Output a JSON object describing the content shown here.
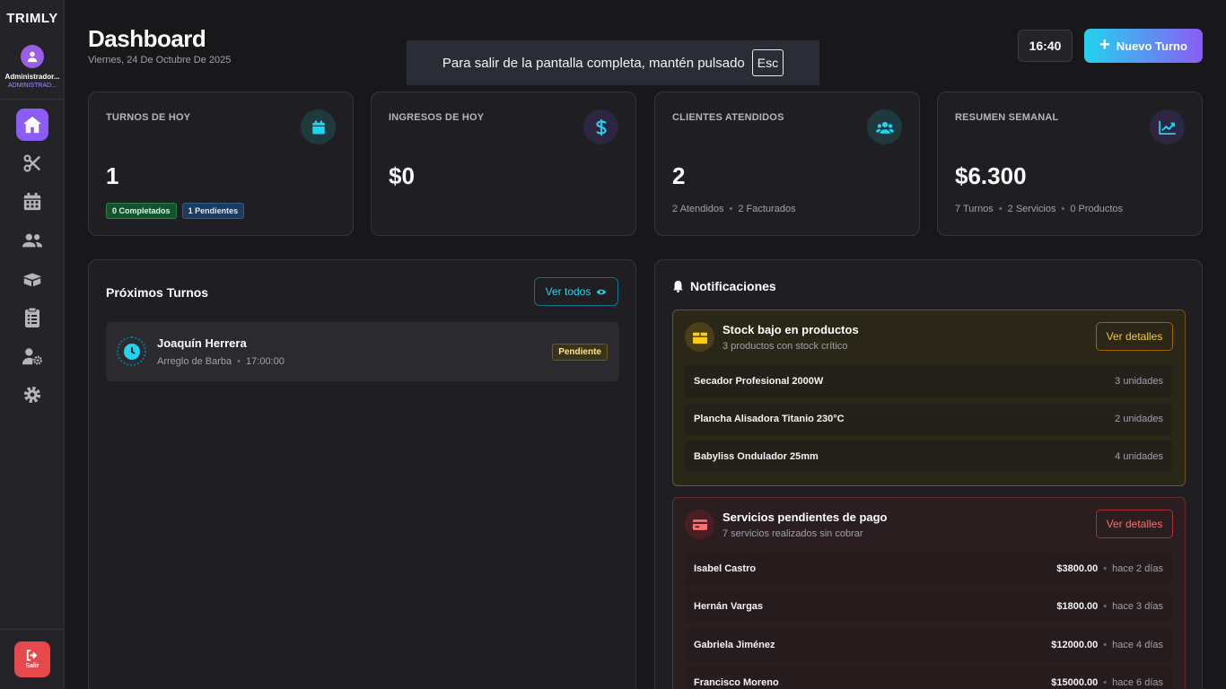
{
  "sidebar": {
    "brand": "TRIMLY",
    "user_name": "Administrador...",
    "user_role": "ADMINISTRAD...",
    "nav_icons": [
      "home-icon",
      "scissors-icon",
      "calendar-icon",
      "users-icon",
      "boxes-icon",
      "clipboard-list-icon",
      "user-gear-icon",
      "gear-icon"
    ],
    "logout_label": "Salir"
  },
  "header": {
    "title": "Dashboard",
    "date": "Viernes, 24 De Octubre De 2025",
    "clock": "16:40",
    "new_button": "Nuevo Turno"
  },
  "fullscreen_banner": {
    "text": "Para salir de la pantalla completa, mantén pulsado",
    "key": "Esc"
  },
  "stats": {
    "turnos": {
      "label": "TURNOS DE HOY",
      "value": "1",
      "badge_completed": "0 Completados",
      "badge_pending": "1 Pendientes"
    },
    "ingresos": {
      "label": "INGRESOS DE HOY",
      "value": "$0"
    },
    "clientes": {
      "label": "CLIENTES ATENDIDOS",
      "value": "2",
      "sub1": "2 Atendidos",
      "sub2": "2 Facturados"
    },
    "resumen": {
      "label": "RESUMEN SEMANAL",
      "value": "$6.300",
      "sub1": "7 Turnos",
      "sub2": "2 Servicios",
      "sub3": "0 Productos"
    }
  },
  "proximos": {
    "title": "Próximos Turnos",
    "ver_todos": "Ver todos",
    "items": [
      {
        "name": "Joaquín Herrera",
        "service": "Arreglo de Barba",
        "time": "17:00:00",
        "status": "Pendiente"
      }
    ]
  },
  "notificaciones": {
    "title": "Notificaciones",
    "stock": {
      "title": "Stock bajo en productos",
      "subtitle": "3 productos con stock crítico",
      "button": "Ver detalles",
      "rows": [
        {
          "name": "Secador Profesional 2000W",
          "qty": "3 unidades"
        },
        {
          "name": "Plancha Alisadora Titanio 230°C",
          "qty": "2 unidades"
        },
        {
          "name": "Babyliss Ondulador 25mm",
          "qty": "4 unidades"
        }
      ]
    },
    "pagos": {
      "title": "Servicios pendientes de pago",
      "subtitle": "7 servicios realizados sin cobrar",
      "button": "Ver detalles",
      "rows": [
        {
          "name": "Isabel Castro",
          "amount": "$3800.00",
          "ago": "hace 2 días"
        },
        {
          "name": "Hernán Vargas",
          "amount": "$1800.00",
          "ago": "hace 3 días"
        },
        {
          "name": "Gabriela Jiménez",
          "amount": "$12000.00",
          "ago": "hace 4 días"
        },
        {
          "name": "Francisco Moreno",
          "amount": "$15000.00",
          "ago": "hace 6 días"
        }
      ]
    }
  },
  "colors": {
    "accent_purple": "#8b5cf6",
    "accent_cyan": "#22d3ee",
    "danger": "#e5484d",
    "warning": "#facc15"
  }
}
